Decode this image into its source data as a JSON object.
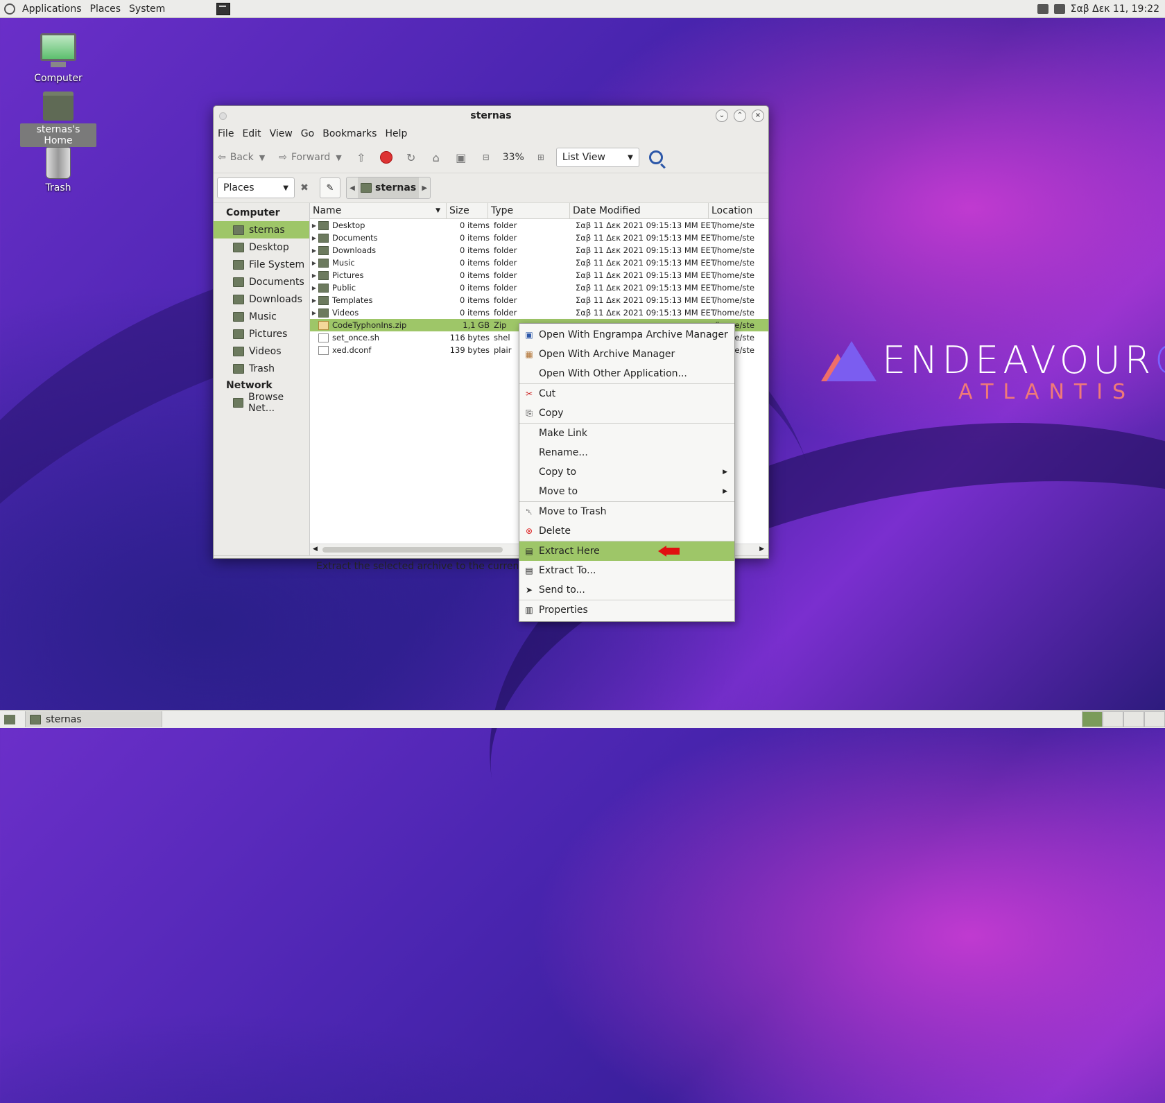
{
  "top_panel": {
    "menus": [
      "Applications",
      "Places",
      "System"
    ],
    "clock": "Σαβ Δεκ 11, 19:22"
  },
  "desktop": {
    "icons": [
      {
        "label": "Computer",
        "icon": "computer-icon"
      },
      {
        "label": "sternas's Home",
        "icon": "home-folder-icon",
        "selected": true
      },
      {
        "label": "Trash",
        "icon": "trash-icon"
      }
    ],
    "logo": {
      "name_main": "ENDEAVOUR",
      "name_os": "OS",
      "subtitle": "ATLANTIS"
    }
  },
  "window": {
    "title": "sternas",
    "menubar": [
      "File",
      "Edit",
      "View",
      "Go",
      "Bookmarks",
      "Help"
    ],
    "toolbar": {
      "back": "Back",
      "forward": "Forward",
      "zoom": "33%",
      "view_mode": "List View"
    },
    "location": {
      "places_label": "Places",
      "crumb": "sternas"
    },
    "sidebar": {
      "sections": [
        {
          "header": "Computer",
          "items": [
            {
              "label": "sternas",
              "selected": true
            },
            {
              "label": "Desktop"
            },
            {
              "label": "File System"
            },
            {
              "label": "Documents"
            },
            {
              "label": "Downloads"
            },
            {
              "label": "Music"
            },
            {
              "label": "Pictures"
            },
            {
              "label": "Videos"
            },
            {
              "label": "Trash"
            }
          ]
        },
        {
          "header": "Network",
          "items": [
            {
              "label": "Browse Net..."
            }
          ]
        }
      ]
    },
    "columns": [
      "Name",
      "Size",
      "Type",
      "Date Modified",
      "Location"
    ],
    "files": [
      {
        "name": "Desktop",
        "size": "0 items",
        "type": "folder",
        "date": "Σαβ 11 Δεκ 2021 09:15:13 MM EET",
        "location": "/home/ste",
        "kind": "folder"
      },
      {
        "name": "Documents",
        "size": "0 items",
        "type": "folder",
        "date": "Σαβ 11 Δεκ 2021 09:15:13 MM EET",
        "location": "/home/ste",
        "kind": "folder"
      },
      {
        "name": "Downloads",
        "size": "0 items",
        "type": "folder",
        "date": "Σαβ 11 Δεκ 2021 09:15:13 MM EET",
        "location": "/home/ste",
        "kind": "folder"
      },
      {
        "name": "Music",
        "size": "0 items",
        "type": "folder",
        "date": "Σαβ 11 Δεκ 2021 09:15:13 MM EET",
        "location": "/home/ste",
        "kind": "folder"
      },
      {
        "name": "Pictures",
        "size": "0 items",
        "type": "folder",
        "date": "Σαβ 11 Δεκ 2021 09:15:13 MM EET",
        "location": "/home/ste",
        "kind": "folder"
      },
      {
        "name": "Public",
        "size": "0 items",
        "type": "folder",
        "date": "Σαβ 11 Δεκ 2021 09:15:13 MM EET",
        "location": "/home/ste",
        "kind": "folder"
      },
      {
        "name": "Templates",
        "size": "0 items",
        "type": "folder",
        "date": "Σαβ 11 Δεκ 2021 09:15:13 MM EET",
        "location": "/home/ste",
        "kind": "folder"
      },
      {
        "name": "Videos",
        "size": "0 items",
        "type": "folder",
        "date": "Σαβ 11 Δεκ 2021 09:15:13 MM EET",
        "location": "/home/ste",
        "kind": "folder"
      },
      {
        "name": "CodeTyphonIns.zip",
        "size": "1,1 GB",
        "type": "Zip",
        "date": "",
        "location": "/home/ste",
        "kind": "zip",
        "selected": true
      },
      {
        "name": "set_once.sh",
        "size": "116 bytes",
        "type": "shel",
        "date": "",
        "location": "/home/ste",
        "kind": "doc"
      },
      {
        "name": "xed.dconf",
        "size": "139 bytes",
        "type": "plair",
        "date": "",
        "location": "/home/ste",
        "kind": "doc"
      }
    ],
    "status": "Extract the selected archive to the curren"
  },
  "context_menu": {
    "groups": [
      [
        {
          "label": "Open With Engrampa Archive Manager",
          "icon": "archive-manager-icon"
        },
        {
          "label": "Open With Archive Manager",
          "icon": "package-icon"
        },
        {
          "label": "Open With Other Application...",
          "icon": ""
        }
      ],
      [
        {
          "label": "Cut",
          "icon": "scissors-icon"
        },
        {
          "label": "Copy",
          "icon": "copy-icon"
        }
      ],
      [
        {
          "label": "Make Link",
          "icon": ""
        },
        {
          "label": "Rename...",
          "icon": ""
        },
        {
          "label": "Copy to",
          "icon": "",
          "submenu": true
        },
        {
          "label": "Move to",
          "icon": "",
          "submenu": true
        }
      ],
      [
        {
          "label": "Move to Trash",
          "icon": "trash-icon"
        },
        {
          "label": "Delete",
          "icon": "delete-icon"
        }
      ],
      [
        {
          "label": "Extract Here",
          "icon": "extract-icon",
          "highlighted": true
        },
        {
          "label": "Extract To...",
          "icon": "extract-icon"
        },
        {
          "label": "Send to...",
          "icon": "send-icon"
        }
      ],
      [
        {
          "label": "Properties",
          "icon": "properties-icon"
        }
      ]
    ]
  },
  "bottom_panel": {
    "task_label": "sternas"
  }
}
